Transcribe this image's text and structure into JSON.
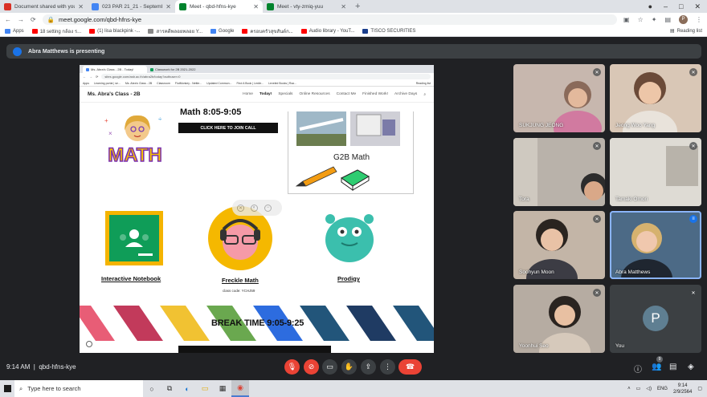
{
  "browser": {
    "tabs": [
      {
        "title": "Document shared with you: \"023 P",
        "favicon_color": "#d93025"
      },
      {
        "title": "023 PAR 21_21 - September 1 - \\",
        "favicon_color": "#4285f4"
      },
      {
        "title": "Meet - qbd-hfns-kye",
        "favicon_color": "#00832d",
        "active": true
      },
      {
        "title": "Meet - vty-zmiq-yuu",
        "favicon_color": "#00832d"
      }
    ],
    "new_tab": "+",
    "window_controls": [
      "●",
      "–",
      "□",
      "✕"
    ],
    "url": "meet.google.com/qbd-hfns-kye",
    "bookmarks": [
      {
        "label": "Apps",
        "color": "#4285f4"
      },
      {
        "label": "18 setting กล้อง ร...",
        "color": "#ff0000"
      },
      {
        "label": "(1) lisa blackpink -...",
        "color": "#ff0000"
      },
      {
        "label": "สารคดีพลอยพลอย Y...",
        "color": "#888888"
      },
      {
        "label": "Google",
        "color": "#4285f4"
      },
      {
        "label": "ครอบครัวสุขสันต์ก...",
        "color": "#ff0000"
      },
      {
        "label": "Audio library - YouT...",
        "color": "#ff0000"
      },
      {
        "label": "TISCO SECURITIES",
        "color": "#1a3e8c"
      }
    ],
    "reading_list": "Reading list"
  },
  "meet": {
    "presenting_text": "Abra Matthews is presenting",
    "time": "9:14 AM",
    "meeting_code": "qbd-hfns-kye",
    "participant_count": "9",
    "participants": [
      {
        "name": "SUKJUNG JEONG",
        "bg": "#c7b7ae"
      },
      {
        "name": "Jeong Woo Yang",
        "bg": "#d9c7b6"
      },
      {
        "name": "Tora",
        "bg": "#b9b2aa"
      },
      {
        "name": "Tamaki Omori",
        "bg": "#c9c7c2"
      },
      {
        "name": "Soohyun Moon",
        "bg": "#c3b5a7"
      },
      {
        "name": "Abra Matthews",
        "bg": "#6e8ea6"
      },
      {
        "name": "Yoonhui Seo",
        "bg": "#b6aca2"
      },
      {
        "name": "You",
        "initial": "P",
        "bg": "#3c4043"
      }
    ]
  },
  "shared": {
    "tabs": [
      "Ms. Abra's Class - 2B - Today!",
      "Classwork for 2B 2021-2022"
    ],
    "url": "sites.google.com/asb.ac.th/abra2b/today?authuser=0",
    "bookmarks": [
      "Apps",
      "Learning portal | se...",
      "Ms. Abra's Class - 2B",
      "Classroom",
      "FlutMonkey - Nettie...",
      "Updated Common...",
      "Find A Book | Lexile...",
      "Leveled Books | Raz...",
      "Reading list"
    ],
    "site_title": "Ms. Abra's Class - 2B",
    "nav": [
      "Home",
      "Today!",
      "Specials",
      "Online Resources",
      "Contact Me",
      "Finished Work!",
      "Archive Days"
    ],
    "math_heading": "Math 8:05-9:05",
    "math_logo": "MATH",
    "join_button": "CLICK HERE TO JOIN CALL",
    "g2b_title": "G2B Math",
    "links": [
      {
        "label": "Interactive Notebook"
      },
      {
        "label": "Freckle Math",
        "sub": "class code: YCHJ59"
      },
      {
        "label": "Prodigy"
      }
    ],
    "break_title": "BREAK TIME 9:05-9:25",
    "stripe_colors": [
      "#e85d76",
      "#e85d76",
      "#c23a5b",
      "#f1c232",
      "#f1c232",
      "#6aa84f",
      "#2d6cdf",
      "#22557a",
      "#1f3b63"
    ]
  },
  "taskbar": {
    "search_placeholder": "Type here to search",
    "tray_lang": "ENG",
    "clock_time": "9:14",
    "clock_date": "2/9/2564"
  }
}
